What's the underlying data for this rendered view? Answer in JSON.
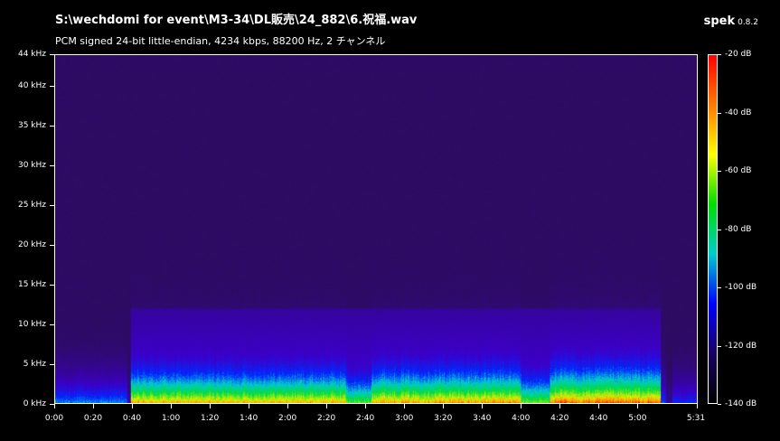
{
  "header": {
    "file_path": "S:\\wechdomi for event\\M3-34\\DL販売\\24_882\\6.祝福.wav",
    "format_info": "PCM signed 24-bit little-endian, 4234 kbps, 88200 Hz, 2 チャンネル",
    "app_name": "spek",
    "app_version": "0.8.2"
  },
  "frequency_axis": {
    "max_khz": 44,
    "labels": [
      "44 kHz",
      "40 kHz",
      "35 kHz",
      "30 kHz",
      "25 kHz",
      "20 kHz",
      "15 kHz",
      "10 kHz",
      "5 kHz",
      "0 kHz"
    ],
    "values_khz": [
      44,
      40,
      35,
      30,
      25,
      20,
      15,
      10,
      5,
      0
    ]
  },
  "time_axis": {
    "duration_seconds": 331,
    "labels": [
      "0:00",
      "0:20",
      "0:40",
      "1:00",
      "1:20",
      "1:40",
      "2:00",
      "2:20",
      "2:40",
      "3:00",
      "3:20",
      "3:40",
      "4:00",
      "4:20",
      "4:40",
      "5:00",
      "5:31"
    ],
    "values_seconds": [
      0,
      20,
      40,
      60,
      80,
      100,
      120,
      140,
      160,
      180,
      200,
      220,
      240,
      260,
      280,
      300,
      331
    ]
  },
  "db_scale": {
    "labels": [
      "-20 dB",
      "-40 dB",
      "-60 dB",
      "-80 dB",
      "-100 dB",
      "-120 dB",
      "-140 dB"
    ],
    "values_db": [
      -20,
      -40,
      -60,
      -80,
      -100,
      -120,
      -140
    ],
    "gradient_colors": [
      "#ff0000",
      "#ff7a00",
      "#ffff00",
      "#00dd00",
      "#00cccc",
      "#0000ff",
      "#1a0060",
      "#000000"
    ]
  },
  "spectrogram": {
    "background_color": "#2d0c5a"
  }
}
